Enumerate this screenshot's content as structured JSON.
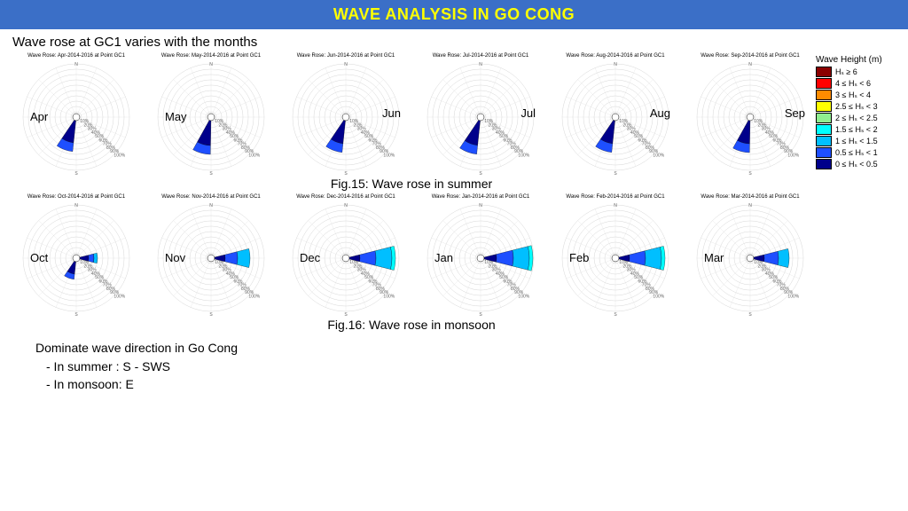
{
  "header": {
    "title": "WAVE ANALYSIS IN GO CONG"
  },
  "subtitle": "Wave rose at GC1 varies with the months",
  "legend": {
    "title": "Wave Height (m)",
    "items": [
      {
        "label": "Hₛ ≥ 6",
        "color": "#8b0000"
      },
      {
        "label": "4 ≤ Hₛ < 6",
        "color": "#ff0000"
      },
      {
        "label": "3 ≤ Hₛ < 4",
        "color": "#ff8c00"
      },
      {
        "label": "2.5 ≤ Hₛ < 3",
        "color": "#ffff00"
      },
      {
        "label": "2 ≤ Hₛ < 2.5",
        "color": "#90ee90"
      },
      {
        "label": "1.5 ≤ Hₛ < 2",
        "color": "#00ffff"
      },
      {
        "label": "1 ≤ Hₛ < 1.5",
        "color": "#00bfff"
      },
      {
        "label": "0.5 ≤ Hₛ < 1",
        "color": "#1e4fff"
      },
      {
        "label": "0 ≤ Hₛ < 0.5",
        "color": "#00008b"
      }
    ]
  },
  "row1": {
    "caption": "Fig.15: Wave rose in summer",
    "roses": [
      {
        "month": "Apr",
        "title": "Wave Rose: Apr-2014-2016 at Point GC1",
        "dir": 200,
        "len": 35,
        "bands": [
          {
            "c": "#00008b",
            "r": 25
          },
          {
            "c": "#1e4fff",
            "r": 10
          }
        ]
      },
      {
        "month": "May",
        "title": "Wave Rose: May-2014-2016 at Point GC1",
        "dir": 195,
        "len": 38,
        "bands": [
          {
            "c": "#00008b",
            "r": 28
          },
          {
            "c": "#1e4fff",
            "r": 10
          }
        ]
      },
      {
        "month": "Jun",
        "title": "Wave Rose: Jun-2014-2016 at Point GC1",
        "dir": 200,
        "len": 36,
        "bands": [
          {
            "c": "#00008b",
            "r": 26
          },
          {
            "c": "#1e4fff",
            "r": 10
          }
        ]
      },
      {
        "month": "Jul",
        "title": "Wave Rose: Jul-2014-2016 at Point GC1",
        "dir": 200,
        "len": 38,
        "bands": [
          {
            "c": "#00008b",
            "r": 28
          },
          {
            "c": "#1e4fff",
            "r": 10
          }
        ]
      },
      {
        "month": "Aug",
        "title": "Wave Rose: Aug-2014-2016 at Point GC1",
        "dir": 200,
        "len": 36,
        "bands": [
          {
            "c": "#00008b",
            "r": 26
          },
          {
            "c": "#1e4fff",
            "r": 10
          }
        ]
      },
      {
        "month": "Sep",
        "title": "Wave Rose: Sep-2014-2016 at Point GC1",
        "dir": 195,
        "len": 36,
        "bands": [
          {
            "c": "#00008b",
            "r": 26
          },
          {
            "c": "#1e4fff",
            "r": 10
          }
        ]
      }
    ]
  },
  "row2": {
    "caption": "Fig.16: Wave rose in monsoon",
    "roses": [
      {
        "month": "Oct",
        "title": "Wave Rose: Oct-2014-2016 at Point GC1",
        "dir": 200,
        "len": 20,
        "bands": [
          {
            "c": "#00008b",
            "r": 14
          },
          {
            "c": "#1e4fff",
            "r": 6
          }
        ],
        "alt": {
          "dir": 90,
          "len": 20,
          "bands": [
            {
              "c": "#00008b",
              "r": 10
            },
            {
              "c": "#1e4fff",
              "r": 6
            },
            {
              "c": "#00bfff",
              "r": 4
            }
          ]
        }
      },
      {
        "month": "Nov",
        "title": "Wave Rose: Nov-2014-2016 at Point GC1",
        "dir": 90,
        "len": 40,
        "bands": [
          {
            "c": "#00008b",
            "r": 12
          },
          {
            "c": "#1e4fff",
            "r": 14
          },
          {
            "c": "#00bfff",
            "r": 14
          }
        ]
      },
      {
        "month": "Dec",
        "title": "Wave Rose: Dec-2014-2016 at Point GC1",
        "dir": 90,
        "len": 52,
        "bands": [
          {
            "c": "#00008b",
            "r": 12
          },
          {
            "c": "#1e4fff",
            "r": 18
          },
          {
            "c": "#00bfff",
            "r": 18
          },
          {
            "c": "#00ffff",
            "r": 4
          }
        ]
      },
      {
        "month": "Jan",
        "title": "Wave Rose: Jan-2014-2016 at Point GC1",
        "dir": 90,
        "len": 55,
        "bands": [
          {
            "c": "#00008b",
            "r": 14
          },
          {
            "c": "#1e4fff",
            "r": 19
          },
          {
            "c": "#00bfff",
            "r": 18
          },
          {
            "c": "#00ffff",
            "r": 4
          }
        ]
      },
      {
        "month": "Feb",
        "title": "Wave Rose: Feb-2014-2016 at Point GC1",
        "dir": 90,
        "len": 52,
        "bands": [
          {
            "c": "#00008b",
            "r": 12
          },
          {
            "c": "#1e4fff",
            "r": 18
          },
          {
            "c": "#00bfff",
            "r": 18
          },
          {
            "c": "#00ffff",
            "r": 4
          }
        ]
      },
      {
        "month": "Mar",
        "title": "Wave Rose: Mar-2014-2016 at Point GC1",
        "dir": 90,
        "len": 40,
        "bands": [
          {
            "c": "#00008b",
            "r": 12
          },
          {
            "c": "#1e4fff",
            "r": 16
          },
          {
            "c": "#00bfff",
            "r": 12
          }
        ]
      }
    ]
  },
  "dominate": {
    "heading": "Dominate wave direction in Go Cong",
    "lines": [
      "- In summer : S - SWS",
      "- In monsoon: E"
    ]
  },
  "chart_data": {
    "type": "wind-rose",
    "note": "Dominant direction and approximate max-frequency % estimated from radial extent; bands indicate wave-height bins (darkest = lowest height)",
    "radial_ticks_pct": [
      10,
      20,
      30,
      40,
      50,
      60,
      70,
      80,
      90,
      100
    ],
    "series": [
      {
        "month": "Apr",
        "dominant_dir_deg": 200,
        "max_freq_pct": 55,
        "dominant_bins": [
          "0-0.5",
          "0.5-1"
        ]
      },
      {
        "month": "May",
        "dominant_dir_deg": 195,
        "max_freq_pct": 60,
        "dominant_bins": [
          "0-0.5",
          "0.5-1"
        ]
      },
      {
        "month": "Jun",
        "dominant_dir_deg": 200,
        "max_freq_pct": 56,
        "dominant_bins": [
          "0-0.5",
          "0.5-1"
        ]
      },
      {
        "month": "Jul",
        "dominant_dir_deg": 200,
        "max_freq_pct": 60,
        "dominant_bins": [
          "0-0.5",
          "0.5-1"
        ]
      },
      {
        "month": "Aug",
        "dominant_dir_deg": 200,
        "max_freq_pct": 56,
        "dominant_bins": [
          "0-0.5",
          "0.5-1"
        ]
      },
      {
        "month": "Sep",
        "dominant_dir_deg": 195,
        "max_freq_pct": 56,
        "dominant_bins": [
          "0-0.5",
          "0.5-1"
        ]
      },
      {
        "month": "Oct",
        "dominant_dir_deg": 90,
        "secondary_dir_deg": 200,
        "max_freq_pct": 35,
        "dominant_bins": [
          "0-0.5",
          "0.5-1",
          "1-1.5"
        ]
      },
      {
        "month": "Nov",
        "dominant_dir_deg": 90,
        "max_freq_pct": 62,
        "dominant_bins": [
          "0-0.5",
          "0.5-1",
          "1-1.5"
        ]
      },
      {
        "month": "Dec",
        "dominant_dir_deg": 90,
        "max_freq_pct": 80,
        "dominant_bins": [
          "0-0.5",
          "0.5-1",
          "1-1.5",
          "1.5-2"
        ]
      },
      {
        "month": "Jan",
        "dominant_dir_deg": 90,
        "max_freq_pct": 85,
        "dominant_bins": [
          "0-0.5",
          "0.5-1",
          "1-1.5",
          "1.5-2"
        ]
      },
      {
        "month": "Feb",
        "dominant_dir_deg": 90,
        "max_freq_pct": 80,
        "dominant_bins": [
          "0-0.5",
          "0.5-1",
          "1-1.5",
          "1.5-2"
        ]
      },
      {
        "month": "Mar",
        "dominant_dir_deg": 90,
        "max_freq_pct": 62,
        "dominant_bins": [
          "0-0.5",
          "0.5-1",
          "1-1.5"
        ]
      }
    ]
  }
}
